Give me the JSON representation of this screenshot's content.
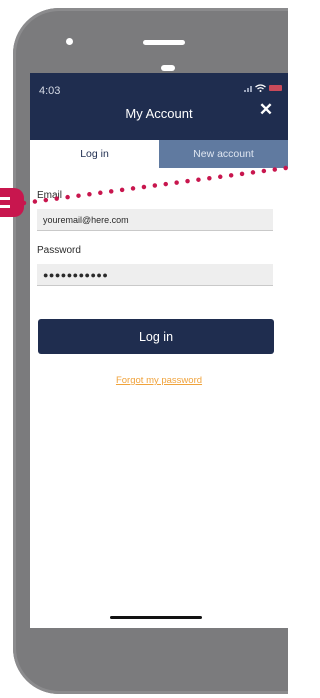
{
  "status_bar": {
    "time": "4:03"
  },
  "header": {
    "title": "My Account",
    "close_glyph": "✕"
  },
  "tabs": [
    {
      "label": "Log in",
      "selected": true
    },
    {
      "label": "New account",
      "selected": false
    }
  ],
  "form": {
    "email_label": "Email",
    "email_value": "youremail@here.com",
    "password_label": "Password",
    "password_value": "●●●●●●●●●●●"
  },
  "login_button": {
    "label": "Log in"
  },
  "forgot_link": {
    "label": "Forgot my password"
  },
  "colors": {
    "header_bg": "#1f2d4f",
    "tab_inactive_bg": "#607aa0",
    "link": "#f0a33c",
    "callout": "#c8164e",
    "phone_frame": "#7b7b7d"
  }
}
